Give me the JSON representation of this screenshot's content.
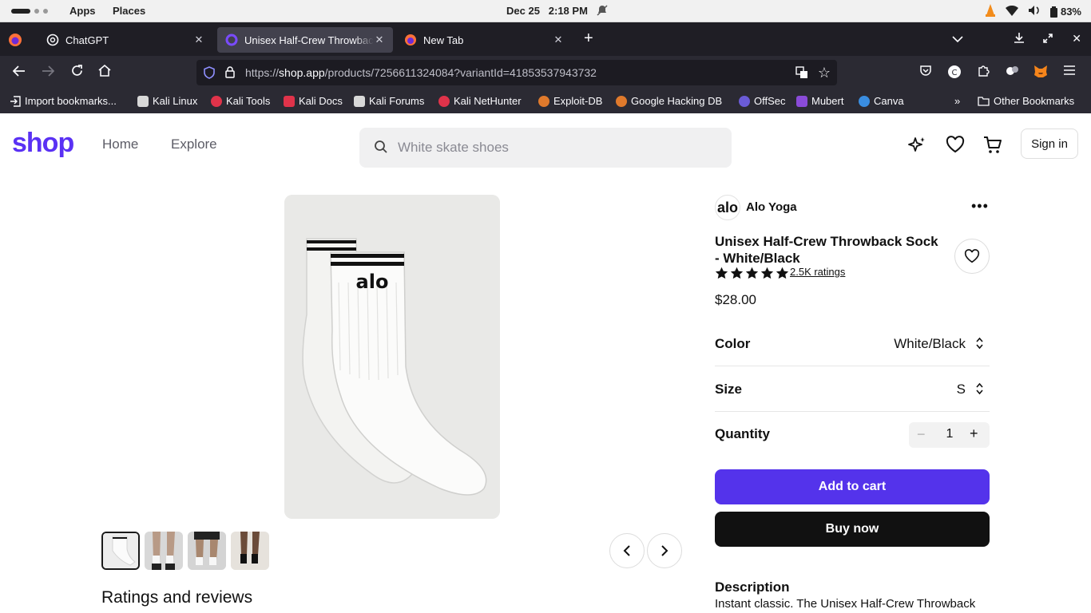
{
  "os": {
    "apps": "Apps",
    "places": "Places",
    "date": "Dec 25",
    "time": "2:18 PM",
    "battery": "83%"
  },
  "tabs": [
    {
      "title": "ChatGPT",
      "icon": "chatgpt-icon"
    },
    {
      "title": "Unisex Half-Crew Throwback",
      "icon": "shop-icon",
      "active": true
    },
    {
      "title": "New Tab",
      "icon": "firefox-icon"
    }
  ],
  "urlbar": {
    "prefix": "https://",
    "host": "shop.app",
    "path": "/products/7256611324084?variantId=41853537943732"
  },
  "bookmarks": [
    {
      "label": "Import bookmarks...",
      "color": "#fbfbfe"
    },
    {
      "label": "Kali Linux",
      "color": "#e0e0e0"
    },
    {
      "label": "Kali Tools",
      "color": "#e0334a"
    },
    {
      "label": "Kali Docs",
      "color": "#e0334a"
    },
    {
      "label": "Kali Forums",
      "color": "#e0e0e0"
    },
    {
      "label": "Kali NetHunter",
      "color": "#e0334a"
    },
    {
      "label": "Exploit-DB",
      "color": "#e07a2c"
    },
    {
      "label": "Google Hacking DB",
      "color": "#e07a2c"
    },
    {
      "label": "OffSec",
      "color": "#6a5bd6"
    },
    {
      "label": "Mubert",
      "color": "#8a4bd8"
    },
    {
      "label": "Canva",
      "color": "#3a8de0"
    },
    {
      "label": "Other Bookmarks",
      "color": "#fbfbfe"
    }
  ],
  "shop": {
    "logo": "shop",
    "nav": [
      "Home",
      "Explore"
    ],
    "search_placeholder": "White skate shoes",
    "sign_in": "Sign in",
    "brand_color": "#5a31f4"
  },
  "product": {
    "shop_name": "Alo Yoga",
    "shop_initials": "alo",
    "title": "Unisex Half-Crew Throwback Sock - White/Black",
    "rating": 5,
    "ratings_count": "2.5K ratings",
    "price": "$28.00",
    "color_label": "Color",
    "color_value": "White/Black",
    "size_label": "Size",
    "size_value": "S",
    "quantity_label": "Quantity",
    "quantity": "1",
    "add_to_cart": "Add to cart",
    "buy_now": "Buy now",
    "description_title": "Description",
    "description_text": "Instant classic. The Unisex Half-Crew Throwback",
    "image_logo": "alo",
    "reviews_title": "Ratings and reviews"
  }
}
